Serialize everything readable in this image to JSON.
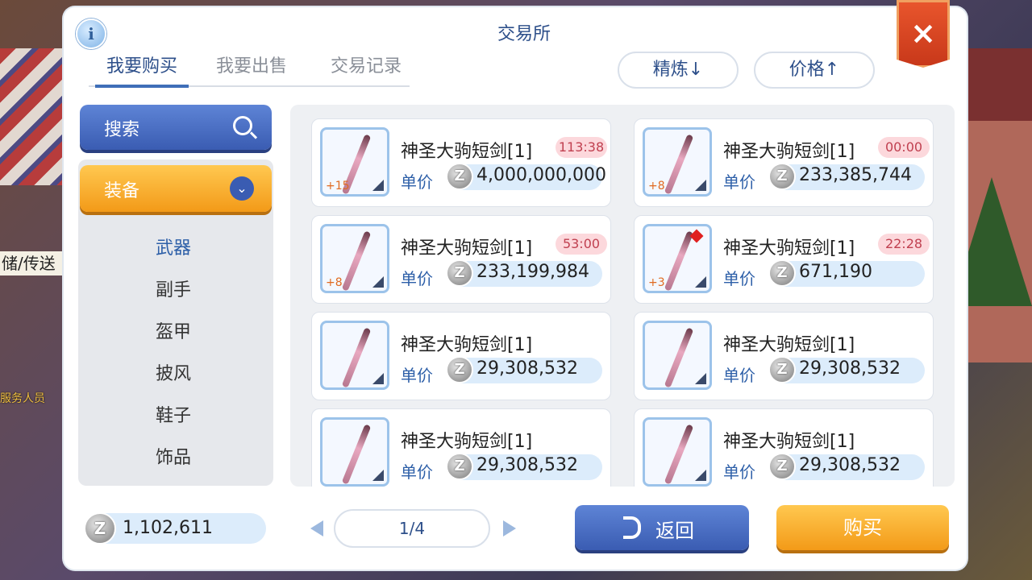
{
  "background": {
    "sign_text": "储/传送",
    "npc_text": "服务人员"
  },
  "window": {
    "title": "交易所",
    "info_icon": "i",
    "close_icon": "×"
  },
  "tabs": [
    {
      "label": "我要购买",
      "active": true
    },
    {
      "label": "我要出售",
      "active": false
    },
    {
      "label": "交易记录",
      "active": false
    }
  ],
  "sort": {
    "refine_label": "精炼↓",
    "price_label": "价格↑"
  },
  "sidebar": {
    "search_label": "搜索",
    "category_label": "装备",
    "chevron": "⌄",
    "subcategories": [
      {
        "label": "武器",
        "active": true
      },
      {
        "label": "副手",
        "active": false
      },
      {
        "label": "盔甲",
        "active": false
      },
      {
        "label": "披风",
        "active": false
      },
      {
        "label": "鞋子",
        "active": false
      },
      {
        "label": "饰品",
        "active": false
      }
    ]
  },
  "currency_icon": "Z",
  "price_label": "单价",
  "items": [
    {
      "name": "神圣大驹短剑[1]",
      "refine": "+15",
      "timer": "113:38",
      "price": "4,000,000,000",
      "gem": false
    },
    {
      "name": "神圣大驹短剑[1]",
      "refine": "+8",
      "timer": "00:00",
      "price": "233,385,744",
      "gem": false
    },
    {
      "name": "神圣大驹短剑[1]",
      "refine": "+8",
      "timer": "53:00",
      "price": "233,199,984",
      "gem": false
    },
    {
      "name": "神圣大驹短剑[1]",
      "refine": "+3",
      "timer": "22:28",
      "price": "671,190",
      "gem": true
    },
    {
      "name": "神圣大驹短剑[1]",
      "refine": "",
      "timer": "",
      "price": "29,308,532",
      "gem": false
    },
    {
      "name": "神圣大驹短剑[1]",
      "refine": "",
      "timer": "",
      "price": "29,308,532",
      "gem": false
    },
    {
      "name": "神圣大驹短剑[1]",
      "refine": "",
      "timer": "",
      "price": "29,308,532",
      "gem": false
    },
    {
      "name": "神圣大驹短剑[1]",
      "refine": "",
      "timer": "",
      "price": "29,308,532",
      "gem": false
    }
  ],
  "footer": {
    "balance": "1,102,611",
    "page": "1/4",
    "back_label": "返回",
    "buy_label": "购买"
  }
}
